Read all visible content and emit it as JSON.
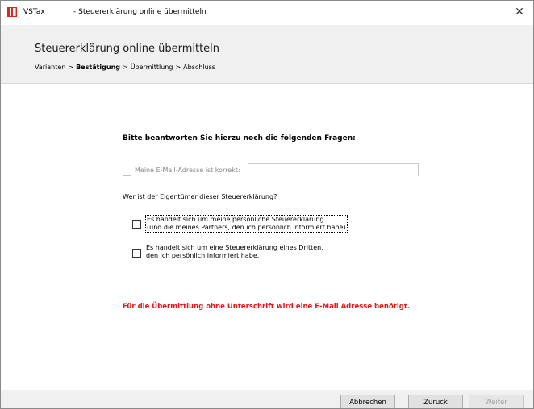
{
  "window": {
    "app_name": "VSTax",
    "title": "- Steuererklärung online übermitteln",
    "close_glyph": "✕"
  },
  "header": {
    "title": "Steuererklärung online übermitteln",
    "breadcrumb": [
      {
        "label": "Varianten",
        "active": false
      },
      {
        "label": "Bestätigung",
        "active": true
      },
      {
        "label": "Übermittlung",
        "active": false
      },
      {
        "label": "Abschluss",
        "active": false
      }
    ],
    "separator": ">"
  },
  "form": {
    "heading": "Bitte beantworten Sie hierzu noch die folgenden Fragen:",
    "email_label": "Meine E-Mail-Adresse ist korrekt:",
    "email_value": "",
    "email_checked": false,
    "email_enabled": false,
    "owner_question": "Wer ist der Eigentümer dieser Steuererklärung?",
    "options": [
      {
        "line1": "Es handelt sich um meine persönliche Steuererklärung",
        "line2": "(und die meines Partners, den ich persönlich informiert habe)",
        "checked": false,
        "focused": true
      },
      {
        "line1": "Es handelt sich um eine Steuererklärung eines Dritten,",
        "line2": "den ich persönlich informiert habe.",
        "checked": false,
        "focused": false
      }
    ],
    "warning": "Für die Übermittlung ohne Unterschrift wird eine E-Mail Adresse benötigt."
  },
  "footer": {
    "cancel_label": "Abbrechen",
    "back_label": "Zurück",
    "next_label": "Weiter",
    "next_enabled": false
  },
  "colors": {
    "warning": "#e8141c",
    "header_bg": "#f0f0f0",
    "icon_red": "#e2231a"
  },
  "icons": {
    "app": "vstax-app-icon",
    "close": "close-icon"
  }
}
